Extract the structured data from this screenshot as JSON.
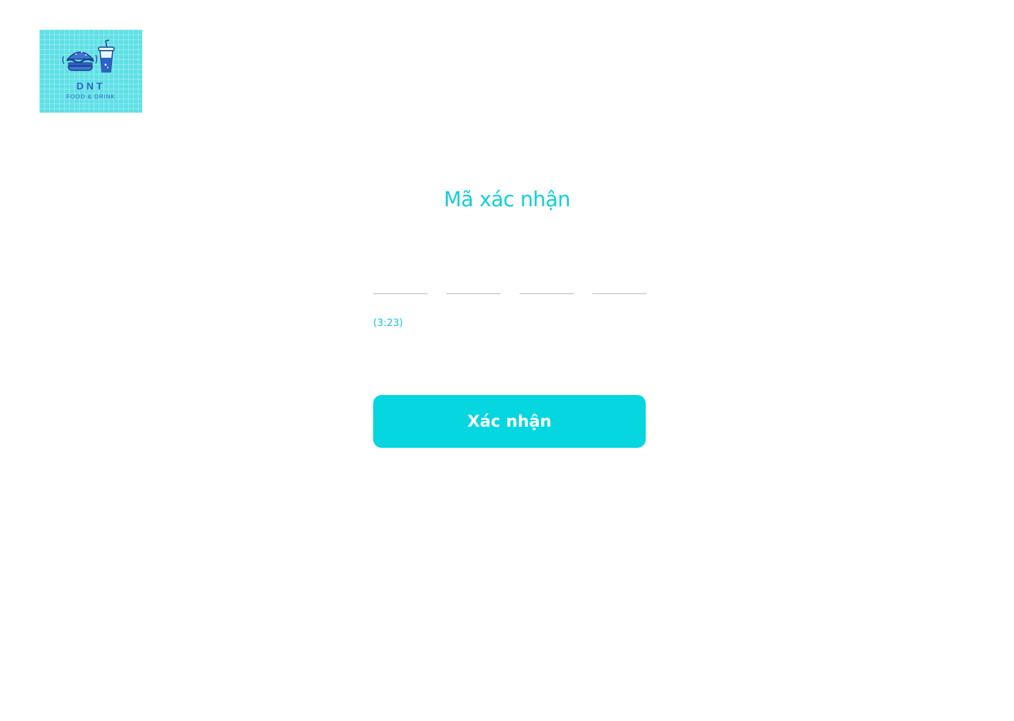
{
  "logo": {
    "icon_food": "burger-icon",
    "icon_drink": "drink-cup-icon",
    "title": "DNT",
    "subtitle": "FOOD & DRINK",
    "background_color": "#5fe0e6",
    "text_color": "#2f63c9"
  },
  "page": {
    "title": "Mã xác nhận"
  },
  "code_inputs": {
    "values": [
      "",
      "",
      "",
      ""
    ]
  },
  "timer": {
    "text": "(3:23)"
  },
  "confirm_button": {
    "label": "Xác nhận",
    "color": "#06d6e0"
  },
  "colors": {
    "accent": "#0fd0dc",
    "input_underline": "#d7d7d7"
  }
}
